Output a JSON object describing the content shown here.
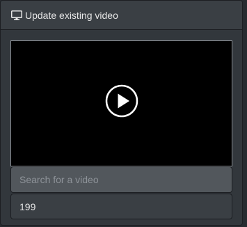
{
  "panel": {
    "title": "Update existing video",
    "title_icon": "monitor-icon"
  },
  "video": {
    "play_icon": "play-circle-icon"
  },
  "search": {
    "placeholder": "Search for a video",
    "value": ""
  },
  "video_id": {
    "value": "199"
  },
  "colors": {
    "panel_bg": "#32373c",
    "heading_bg": "#3a3f44",
    "video_bg": "#000000",
    "search_bg": "#52575c",
    "id_bg": "#3a3f44",
    "text": "#e6e6e6"
  }
}
